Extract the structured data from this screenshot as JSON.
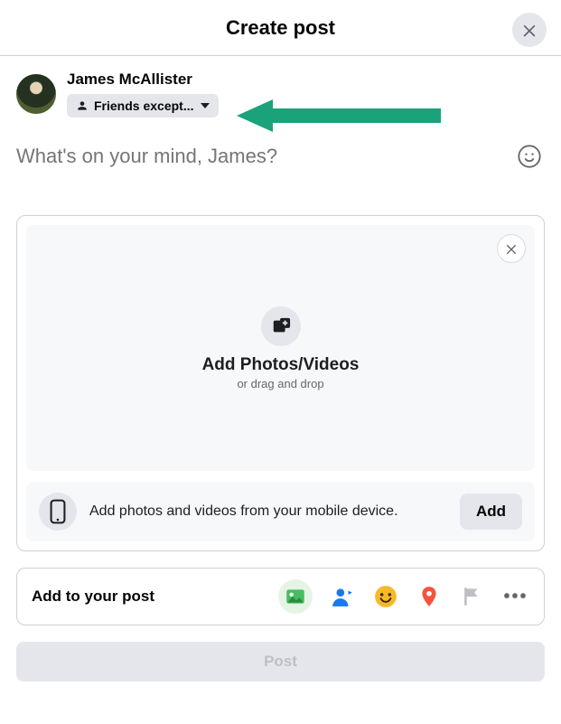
{
  "header": {
    "title": "Create post"
  },
  "user": {
    "name": "James McAllister",
    "audience_label": "Friends except..."
  },
  "composer": {
    "placeholder": "What's on your mind, James?"
  },
  "media": {
    "dropzone_title": "Add Photos/Videos",
    "dropzone_subtitle": "or drag and drop",
    "mobile_text": "Add photos and videos from your mobile device.",
    "mobile_add_label": "Add"
  },
  "attach": {
    "label": "Add to your post"
  },
  "post": {
    "button_label": "Post"
  },
  "colors": {
    "arrow": "#1aa37a"
  },
  "icons": {
    "close": "close-icon",
    "audience": "people-silhouette-icon",
    "emoji": "smile-icon",
    "add_media": "photo-plus-icon",
    "phone": "phone-icon",
    "photo": "photo-icon",
    "tag": "tag-person-icon",
    "feeling": "feeling-emoji-icon",
    "location": "location-pin-icon",
    "flag": "flag-icon",
    "more": "more-dots-icon"
  }
}
